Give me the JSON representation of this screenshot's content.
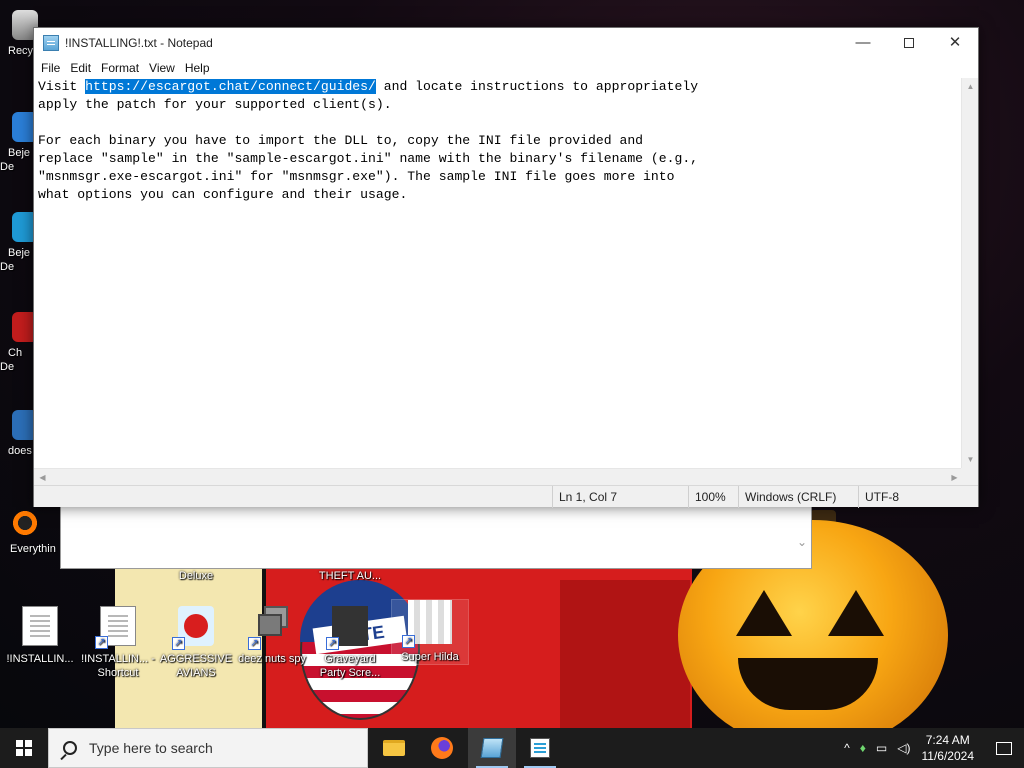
{
  "desktop": {
    "icons_bottom": [
      {
        "label": "!INSTALLIN...",
        "shortcut": false
      },
      {
        "label": "!INSTALLIN... - Shortcut",
        "shortcut": true
      },
      {
        "label": "AGGRESSIVE AVIANS",
        "shortcut": true
      },
      {
        "label": "deez nuts spy",
        "shortcut": true
      },
      {
        "label": "Graveyard Party Scre...",
        "shortcut": true
      },
      {
        "label": "Super Hilda",
        "shortcut": true
      }
    ],
    "icons_left": [
      "Recy",
      "Beje De",
      "Beje De",
      "Ch De",
      "does",
      "Everythin"
    ],
    "partial_labels": {
      "deluxe": "Deluxe",
      "theft": "THEFT AU..."
    },
    "wallpaper_text": "VOTE"
  },
  "notepad": {
    "title": "!INSTALLING!.txt - Notepad",
    "menu": [
      "File",
      "Edit",
      "Format",
      "View",
      "Help"
    ],
    "content": {
      "line1_pre": "Visit ",
      "line1_selected": "https://escargot.chat/connect/guides/",
      "line1_post": " and locate instructions to appropriately",
      "line2": "apply the patch for your supported client(s).",
      "line3": "",
      "line4": "For each binary you have to import the DLL to, copy the INI file provided and",
      "line5": "replace \"sample\" in the \"sample-escargot.ini\" name with the binary's filename (e.g.,",
      "line6": "\"msnmsgr.exe-escargot.ini\" for \"msnmsgr.exe\"). The sample INI file goes more into",
      "line7": "what options you can configure and their usage."
    },
    "status": {
      "position": "Ln 1, Col 7",
      "zoom": "100%",
      "line_endings": "Windows (CRLF)",
      "encoding": "UTF-8"
    },
    "selection_color": "#0078d7"
  },
  "taskbar": {
    "search_placeholder": "Type here to search",
    "apps": [
      "file-explorer",
      "firefox",
      "notepad",
      "notepad-2"
    ],
    "time": "7:24 AM",
    "date": "11/6/2024",
    "tray_chevron": "^"
  }
}
